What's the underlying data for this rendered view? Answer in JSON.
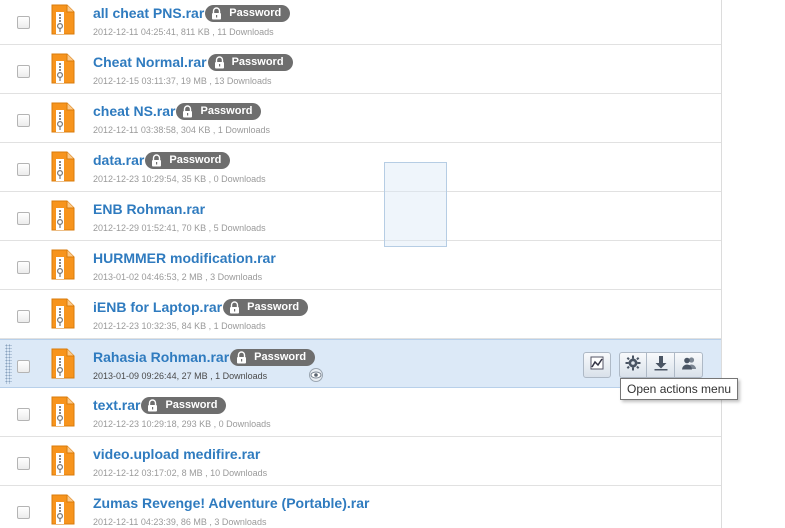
{
  "colors": {
    "link": "#2f7bbf",
    "badge": "#6e6e6e",
    "selected_row": "#dce9f7",
    "file_icon": "#f7941d"
  },
  "files": [
    {
      "name": "all cheat PNS.rar",
      "password": true,
      "meta": "2012-12-11 04:25:41, 811 KB , 11 Downloads"
    },
    {
      "name": "Cheat Normal.rar",
      "password": true,
      "meta": "2012-12-15 03:11:37, 19 MB , 13 Downloads"
    },
    {
      "name": "cheat NS.rar",
      "password": true,
      "meta": "2012-12-11 03:38:58, 304 KB , 1 Downloads"
    },
    {
      "name": "data.rar",
      "password": true,
      "meta": "2012-12-23 10:29:54, 35 KB , 0 Downloads"
    },
    {
      "name": "ENB Rohman.rar",
      "password": false,
      "meta": "2012-12-29 01:52:41, 70 KB , 5 Downloads"
    },
    {
      "name": "HURMMER modification.rar",
      "password": false,
      "meta": "2013-01-02 04:46:53, 2 MB , 3 Downloads"
    },
    {
      "name": "iENB for Laptop.rar",
      "password": true,
      "meta": "2012-12-23 10:32:35, 84 KB , 1 Downloads"
    },
    {
      "name": "Rahasia Rohman.rar",
      "password": true,
      "meta": "2013-01-09 09:26:44, 27 MB , 1 Downloads",
      "selected": true
    },
    {
      "name": "text.rar",
      "password": true,
      "meta": "2012-12-23 10:29:18, 293 KB , 0 Downloads"
    },
    {
      "name": "video.upload medifire.rar",
      "password": false,
      "meta": "2012-12-12 03:17:02, 8 MB , 10 Downloads"
    },
    {
      "name": "Zumas Revenge! Adventure (Portable).rar",
      "password": false,
      "meta": "2012-12-11 04:23:39, 86 MB , 3 Downloads"
    }
  ],
  "badge_label": "Password",
  "row_icons": {
    "file": "zip-file-icon",
    "lock": "lock-icon",
    "eye": "eye-icon"
  },
  "actions": [
    {
      "name": "stats-button",
      "icon": "chart-icon"
    },
    {
      "name": "settings-button",
      "icon": "gear-icon"
    },
    {
      "name": "download-button",
      "icon": "download-icon"
    },
    {
      "name": "share-button",
      "icon": "users-icon"
    }
  ],
  "tooltip": "Open actions menu"
}
